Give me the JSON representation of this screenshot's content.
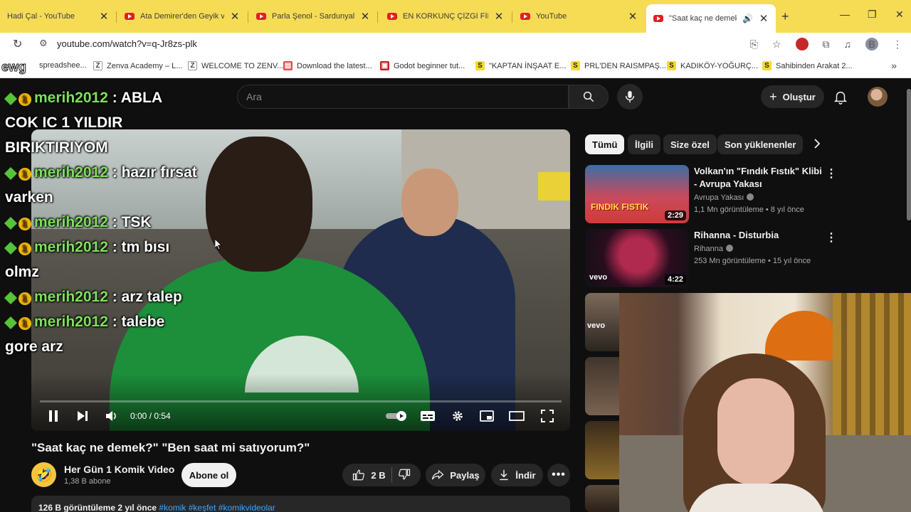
{
  "browser": {
    "tabs": [
      {
        "title": "Hadi Çal - YouTube",
        "favicon": "youtube-icon"
      },
      {
        "title": "Ata Demirer'den Geyik ve",
        "favicon": "youtube-icon"
      },
      {
        "title": "Parla Şenol - Sardunyalar",
        "favicon": "youtube-icon"
      },
      {
        "title": "EN KORKUNÇ ÇİZGİ FİLM",
        "favicon": "youtube-icon"
      },
      {
        "title": "YouTube",
        "favicon": "youtube-icon"
      },
      {
        "title": "\"Saat kaç ne demek?\"",
        "favicon": "youtube-icon",
        "active": true,
        "audio": true
      }
    ],
    "url": "youtube.com/watch?v=q-Jr8zs-plk",
    "profile_initial": "B",
    "bookmarks": [
      {
        "label": "spreadshee...",
        "icon": "sheets-icon"
      },
      {
        "label": "Zenva Academy – L...",
        "icon": "zenva-icon",
        "glyph": "Z"
      },
      {
        "label": "WELCOME TO ZENV...",
        "icon": "zenva-icon",
        "glyph": "Z"
      },
      {
        "label": "Download the latest...",
        "icon": "download-site-icon",
        "glyph": "▤"
      },
      {
        "label": "Godot beginner tut...",
        "icon": "godot-icon",
        "glyph": "▣"
      },
      {
        "label": "\"KAPTAN İNŞAAT E...",
        "icon": "sahibinden-icon",
        "glyph": "S"
      },
      {
        "label": "PRL'DEN RAISMPAŞ...",
        "icon": "sahibinden-icon",
        "glyph": "S"
      },
      {
        "label": "KADIKÖY-YOĞURÇ...",
        "icon": "sahibinden-icon",
        "glyph": "S"
      },
      {
        "label": "Sahibinden Arakat 2...",
        "icon": "sahibinden-icon",
        "glyph": "S"
      }
    ],
    "overlay_text": "ewg"
  },
  "youtube": {
    "search_placeholder": "Ara",
    "create_label": "Oluştur",
    "video": {
      "title": "\"Saat kaç ne demek?\" \"Ben saat mi satıyorum?\"",
      "time": "0:00 / 0:54",
      "progress": 0
    },
    "channel": {
      "name": "Her Gün 1 Komik Video",
      "subs": "1,38 B abone",
      "avatar_emoji": "🤣"
    },
    "subscribe_label": "Abone ol",
    "likes": "2 B",
    "share_label": "Paylaş",
    "download_label": "İndir",
    "description": {
      "stats": "126 B görüntüleme  2 yıl önce",
      "tags": "#komik #keşfet #komikvideolar"
    },
    "chips": [
      "Tümü",
      "İlgili",
      "Size özel",
      "Son yüklenenler"
    ],
    "recommendations": [
      {
        "title": "Volkan'ın \"Fındık Fıstık\" Klibi - Avrupa Yakası",
        "channel": "Avrupa Yakası",
        "meta": "1,1 Mn görüntüleme • 8 yıl önce",
        "duration": "2:29"
      },
      {
        "title": "Rihanna - Disturbia",
        "channel": "Rihanna",
        "meta": "253 Mn görüntüleme • 15 yıl önce",
        "duration": "4:22"
      }
    ]
  },
  "chat": [
    {
      "user": "merih2012",
      "text": "ABLA COK IC 1 YILDIR BIRIKTIRIYOM"
    },
    {
      "user": "merih2012",
      "text": "hazır fırsat varken"
    },
    {
      "user": "merih2012",
      "text": "TSK"
    },
    {
      "user": "merih2012",
      "text": "tm bısı olmz"
    },
    {
      "user": "merih2012",
      "text": "arz talep"
    },
    {
      "user": "merih2012",
      "text": "talebe gore arz"
    }
  ],
  "chat_badge_coin": "1",
  "thumb_texts": {
    "findik": "FINDIK FISTIK",
    "vevo": "vevo"
  }
}
